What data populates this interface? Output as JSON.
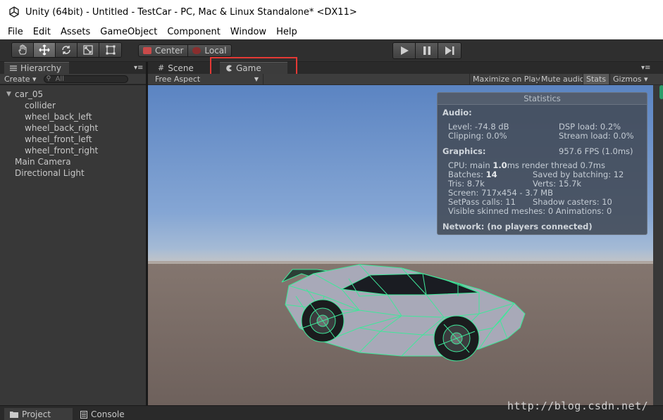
{
  "window": {
    "title": "Unity (64bit) - Untitled - TestCar - PC, Mac & Linux Standalone* <DX11>"
  },
  "menu": [
    "File",
    "Edit",
    "Assets",
    "GameObject",
    "Component",
    "Window",
    "Help"
  ],
  "toolbar": {
    "tools": [
      "hand-tool-icon",
      "move-tool-icon",
      "rotate-tool-icon",
      "scale-tool-icon",
      "rect-tool-icon"
    ],
    "pivot": {
      "center_label": "Center",
      "local_label": "Local"
    },
    "colors": {
      "center": "#c94a4a",
      "local": "#8a2e2e"
    }
  },
  "hierarchy": {
    "tab_label": "Hierarchy",
    "create_label": "Create",
    "search_placeholder": "All",
    "items": [
      {
        "label": "car_05",
        "depth": 0,
        "expanded": true
      },
      {
        "label": "collider",
        "depth": 1
      },
      {
        "label": "wheel_back_left",
        "depth": 1
      },
      {
        "label": "wheel_back_right",
        "depth": 1
      },
      {
        "label": "wheel_front_left",
        "depth": 1
      },
      {
        "label": "wheel_front_right",
        "depth": 1
      },
      {
        "label": "Main Camera",
        "depth": 0
      },
      {
        "label": "Directional Light",
        "depth": 0
      }
    ]
  },
  "game_panel": {
    "scene_tab": "Scene",
    "game_tab": "Game",
    "aspect": "Free Aspect",
    "buttons": {
      "maximize": "Maximize on Play",
      "mute": "Mute audio",
      "stats": "Stats",
      "gizmos": "Gizmos"
    }
  },
  "stats": {
    "title": "Statistics",
    "audio_heading": "Audio:",
    "level": "Level: -74.8 dB",
    "dsp_load": "DSP load: 0.2%",
    "clipping": "Clipping: 0.0%",
    "stream_load": "Stream load: 0.0%",
    "graphics_heading": "Graphics:",
    "fps": "957.6 FPS (1.0ms)",
    "cpu_prefix": "CPU: main ",
    "cpu_main": "1.0",
    "cpu_suffix": "ms  render thread 0.7ms",
    "batches_prefix": "Batches: ",
    "batches": "14",
    "saved_batching": "Saved by batching: 12",
    "tris": "Tris: 8.7k",
    "verts": "Verts: 15.7k",
    "screen": "Screen: 717x454 - 3.7 MB",
    "setpass": "SetPass calls: 11",
    "shadow_casters": "Shadow casters: 10",
    "skinned": "Visible skinned meshes: 0  Animations: 0",
    "network": "Network: (no players connected)"
  },
  "bottom_tabs": {
    "project": "Project",
    "console": "Console"
  },
  "watermark": "http://blog.csdn.net/"
}
